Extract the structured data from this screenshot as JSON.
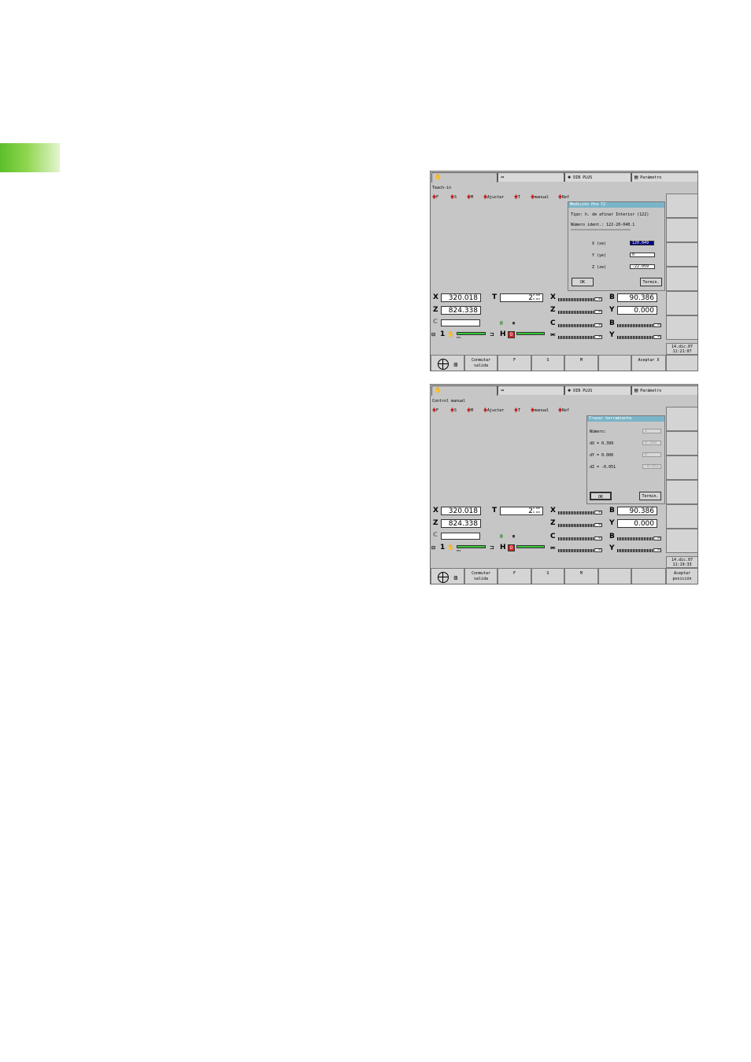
{
  "screens": [
    {
      "tabs": [
        {
          "icon": "✋",
          "label": ""
        },
        {
          "icon": "⇛",
          "label": ""
        },
        {
          "icon": "◈",
          "label": "DIN PLUS"
        },
        {
          "icon": "▤",
          "label": "Parámetro"
        }
      ],
      "mode": "Teach-in",
      "icon_items": [
        "F",
        "S",
        "M",
        "Ajustar",
        "T",
        "manual",
        "Ref"
      ],
      "dialog": {
        "title": "Medición Hta T2",
        "lines": [
          "Tipo: h. de afinar Interior (122)",
          "Número ident.: 122-20-040.1",
          "=========================================="
        ],
        "fields": [
          {
            "label": "X (xe)",
            "value": "120.049"
          },
          {
            "label": "Y (ye)",
            "value": "0"
          },
          {
            "label": "Z (ze)",
            "value": "-22.059"
          }
        ],
        "ok": "OK",
        "cancel": "Termin."
      },
      "positions": {
        "X": "320.018",
        "Z": "824.338",
        "T": "2",
        "B": "90.386",
        "Y": "0.000",
        "C": ""
      },
      "date": "14.dic.07",
      "time": "11:21:07",
      "softkeys": [
        "Conmutar salida",
        "F",
        "S",
        "M",
        "",
        "Aceptar X"
      ]
    },
    {
      "tabs": [
        {
          "icon": "✋",
          "label": ""
        },
        {
          "icon": "⇛",
          "label": ""
        },
        {
          "icon": "◈",
          "label": "DIN PLUS"
        },
        {
          "icon": "▤",
          "label": "Parámetro"
        }
      ],
      "mode": "Control manual",
      "icon_items": [
        "F",
        "S",
        "M",
        "Ajustar",
        "T",
        "manual",
        "Ref"
      ],
      "dialog": {
        "title": "Trazar herramienta",
        "fields": [
          {
            "label": "Número:",
            "value": "2"
          },
          {
            "label": "dX = 0.399",
            "value": "0.399"
          },
          {
            "label": "dY = 0.000",
            "value": "0"
          },
          {
            "label": "dZ = -0.051",
            "value": "-0.051"
          }
        ],
        "ok": "OK",
        "cancel": "Termin."
      },
      "positions": {
        "X": "320.018",
        "Z": "824.338",
        "T": "2",
        "B": "90.386",
        "Y": "0.000",
        "C": ""
      },
      "date": "14.dic.07",
      "time": "11:19:33",
      "softkeys": [
        "Conmutar salida",
        "F",
        "S",
        "M",
        "",
        "Aceptar posición"
      ]
    }
  ],
  "small_labels": {
    "t_top": "0.108",
    "t_bottom": "0.204",
    "scale_lo": "50",
    "scale_mid": "100",
    "scale_hi": "200",
    "pct": "0%",
    "green_pct": "85%"
  }
}
